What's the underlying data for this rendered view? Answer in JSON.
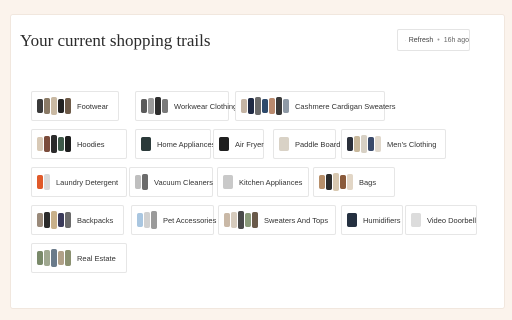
{
  "header": {
    "title": "Your current shopping trails",
    "refresh_label": "Refresh",
    "separator": "•",
    "updated_ago": "16h ago"
  },
  "trails": [
    {
      "label": "Footwear",
      "thumbs": [
        "#3a3a3a",
        "#8a7a66",
        "#c9b9a3",
        "#222222",
        "#6d5a48"
      ]
    },
    {
      "label": "Workwear Clothing",
      "thumbs": [
        "#5b5b5b",
        "#9c9c9c",
        "#2f2f2f",
        "#7a7a7a"
      ]
    },
    {
      "label": "Cashmere Cardigan Sweaters",
      "thumbs": [
        "#c4b4a4",
        "#1f2a44",
        "#6a6a6a",
        "#2e4a6b",
        "#b98a6e",
        "#3a3a3a",
        "#8f9aa6"
      ]
    },
    {
      "label": "Hoodies",
      "thumbs": [
        "#d8c9b6",
        "#7b4b3a",
        "#2b2b2b",
        "#3f5a4a",
        "#1e1e1e"
      ]
    },
    {
      "label": "Home Appliances",
      "thumbs": [
        "#2b3a3a"
      ]
    },
    {
      "label": "Air Fryer",
      "thumbs": [
        "#1f1f1f"
      ]
    },
    {
      "label": "Paddle Board",
      "thumbs": [
        "#d9d2c6"
      ]
    },
    {
      "label": "Men's Clothing",
      "thumbs": [
        "#2a2f3a",
        "#c8b89c",
        "#d7d0c4",
        "#3a4a6a",
        "#e0d8cc"
      ]
    },
    {
      "label": "Laundry Detergent",
      "thumbs": [
        "#e05a2a",
        "#d9d9d9"
      ]
    },
    {
      "label": "Vacuum Cleaners",
      "thumbs": [
        "#bfbfbf",
        "#6b6b6b"
      ]
    },
    {
      "label": "Kitchen Appliances",
      "thumbs": [
        "#c9c9c9"
      ]
    },
    {
      "label": "Bags",
      "thumbs": [
        "#b78f6a",
        "#2c2c2c",
        "#d8c8b0",
        "#8a5a3a",
        "#e2d6c6"
      ]
    },
    {
      "label": "Backpacks",
      "thumbs": [
        "#9a8a7a",
        "#2a2a2a",
        "#c8b08a",
        "#3a3a5a",
        "#6a6a6a"
      ]
    },
    {
      "label": "Pet Accessories",
      "thumbs": [
        "#a9c6e0",
        "#d0d0d0",
        "#9a9a9a"
      ]
    },
    {
      "label": "Sweaters And Tops",
      "thumbs": [
        "#c9b8a6",
        "#d6cbbd",
        "#4a4a4a",
        "#8a9a7a",
        "#6a5a4a"
      ]
    },
    {
      "label": "Humidifiers",
      "thumbs": [
        "#243040"
      ]
    },
    {
      "label": "Video Doorbell",
      "thumbs": [
        "#dcdcdc"
      ]
    },
    {
      "label": "Real Estate",
      "thumbs": [
        "#7a8a6a",
        "#a0a890",
        "#6a7a8a",
        "#b0a088",
        "#8a9070"
      ]
    }
  ]
}
